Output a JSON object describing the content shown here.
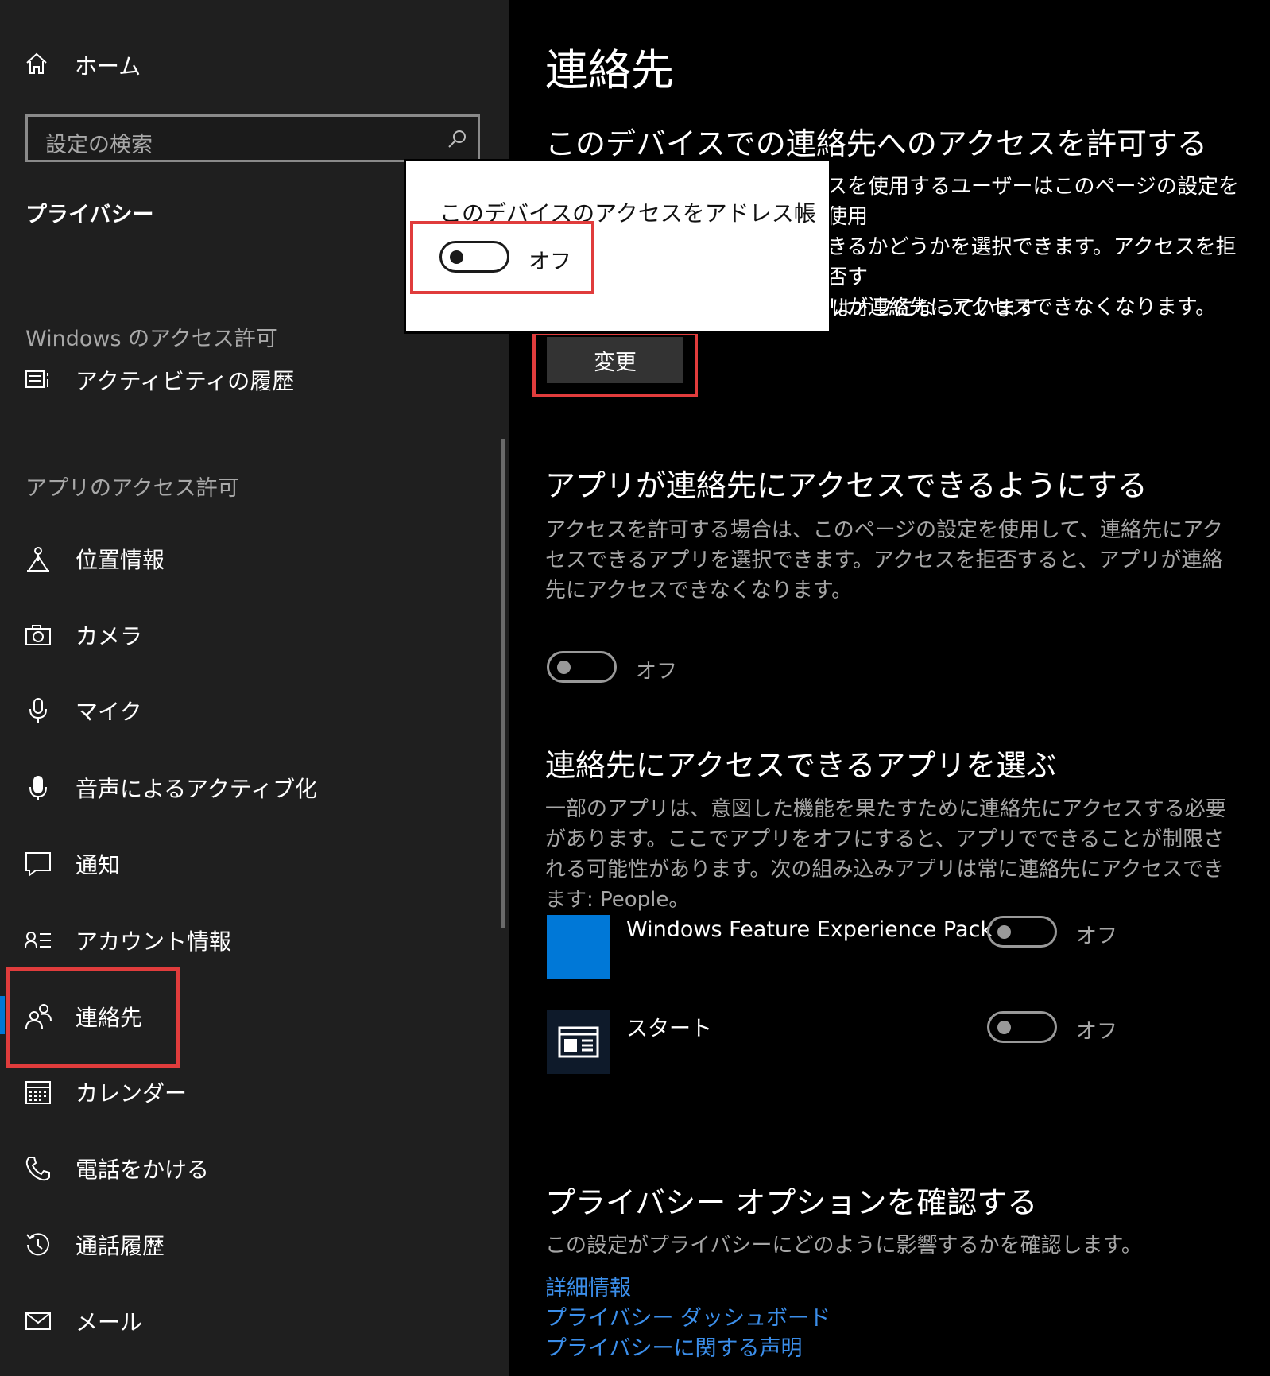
{
  "sidebar": {
    "home_label": "ホーム",
    "search_placeholder": "設定の検索",
    "privacy_heading": "プライバシー",
    "windows_section_label": "Windows のアクセス許可",
    "app_section_label": "アプリのアクセス許可",
    "items": [
      {
        "label": "アクティビティの履歴",
        "icon": "activity-history-icon"
      },
      {
        "label": "位置情報",
        "icon": "location-icon"
      },
      {
        "label": "カメラ",
        "icon": "camera-icon"
      },
      {
        "label": "マイク",
        "icon": "microphone-icon"
      },
      {
        "label": "音声によるアクティブ化",
        "icon": "voice-activation-icon"
      },
      {
        "label": "通知",
        "icon": "notification-icon"
      },
      {
        "label": "アカウント情報",
        "icon": "account-info-icon"
      },
      {
        "label": "連絡先",
        "icon": "contacts-icon",
        "selected": true
      },
      {
        "label": "カレンダー",
        "icon": "calendar-icon"
      },
      {
        "label": "電話をかける",
        "icon": "phone-icon"
      },
      {
        "label": "通話履歴",
        "icon": "call-history-icon"
      },
      {
        "label": "メール",
        "icon": "mail-icon"
      }
    ]
  },
  "main": {
    "title": "連絡先",
    "device_access": {
      "heading": "このデバイスでの連絡先へのアクセスを許可する",
      "description_visible": "スを使用するユーザーはこのページの設定を使用\nきるかどうかを選択できます。アクセスを拒否す\nリが連絡先にアクセスできなくなります。",
      "status_visible": "はオフになっています",
      "change_button": "変更"
    },
    "app_access": {
      "heading": "アプリが連絡先にアクセスできるようにする",
      "description": "アクセスを許可する場合は、このページの設定を使用して、連絡先にアクセスできるアプリを選択できます。アクセスを拒否すると、アプリが連絡先にアクセスできなくなります。",
      "toggle_label": "オフ",
      "toggle_on": false
    },
    "choose_apps": {
      "heading": "連絡先にアクセスできるアプリを選ぶ",
      "description": "一部のアプリは、意図した機能を果たすために連絡先にアクセスする必要があります。ここでアプリをオフにすると、アプリでできることが制限される可能性があります。次の組み込みアプリは常に連絡先にアクセスできます: People。",
      "apps": [
        {
          "name": "Windows Feature Experience Pack",
          "toggle_label": "オフ",
          "toggle_on": false,
          "tile_color": "#0078d7"
        },
        {
          "name": "スタート",
          "toggle_label": "オフ",
          "toggle_on": false,
          "tile_color": "#0e1a2a"
        }
      ]
    },
    "privacy_options": {
      "heading": "プライバシー オプションを確認する",
      "description": "この設定がプライバシーにどのように影響するかを確認します。",
      "links": [
        "詳細情報",
        "プライバシー ダッシュボード",
        "プライバシーに関する声明"
      ]
    }
  },
  "popup": {
    "title": "このデバイスのアクセスをアドレス帳",
    "toggle_label": "オフ",
    "toggle_on": false
  },
  "colors": {
    "accent": "#0078d7",
    "link": "#3b8eea",
    "highlight": "#e03c3c",
    "sidebar_bg": "#1f1f1f",
    "main_bg": "#000000"
  }
}
